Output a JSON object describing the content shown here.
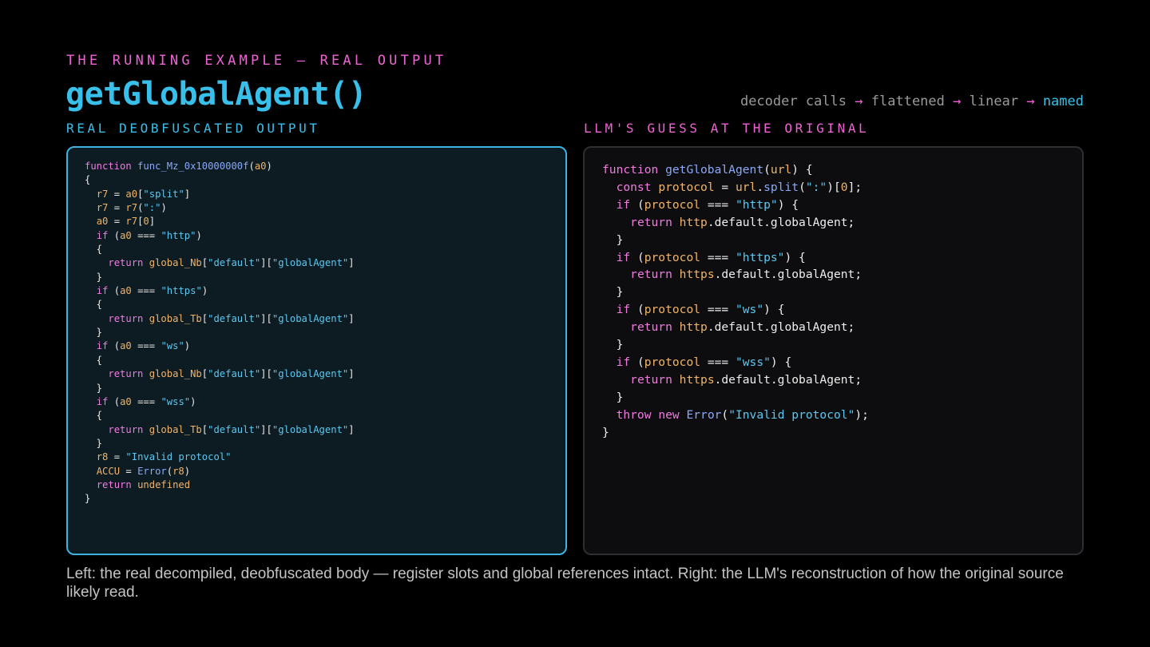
{
  "header": {
    "eyebrow": "THE RUNNING EXAMPLE — REAL OUTPUT",
    "title": "getGlobalAgent()",
    "pipeline": [
      "decoder calls",
      "flattened",
      "linear",
      "named"
    ],
    "arrow": "→"
  },
  "left": {
    "label": "REAL DEOBFUSCATED OUTPUT",
    "code": [
      [
        [
          "kw",
          "function"
        ],
        [
          "p",
          " "
        ],
        [
          "fn",
          "func_Mz_0x10000000f"
        ],
        [
          "p",
          "("
        ],
        [
          "var",
          "a0"
        ],
        [
          "p",
          ")"
        ]
      ],
      [
        [
          "p",
          "{"
        ]
      ],
      [
        [
          "p",
          "  "
        ],
        [
          "var",
          "r7"
        ],
        [
          "p",
          " = "
        ],
        [
          "var",
          "a0"
        ],
        [
          "p",
          "["
        ],
        [
          "str",
          "\"split\""
        ],
        [
          "p",
          "]"
        ]
      ],
      [
        [
          "p",
          "  "
        ],
        [
          "var",
          "r7"
        ],
        [
          "p",
          " = "
        ],
        [
          "var",
          "r7"
        ],
        [
          "p",
          "("
        ],
        [
          "str",
          "\":\""
        ],
        [
          "p",
          ")"
        ]
      ],
      [
        [
          "p",
          "  "
        ],
        [
          "var",
          "a0"
        ],
        [
          "p",
          " = "
        ],
        [
          "var",
          "r7"
        ],
        [
          "p",
          "["
        ],
        [
          "num",
          "0"
        ],
        [
          "p",
          "]"
        ]
      ],
      [
        [
          "p",
          "  "
        ],
        [
          "kw",
          "if"
        ],
        [
          "p",
          " ("
        ],
        [
          "var",
          "a0"
        ],
        [
          "p",
          " === "
        ],
        [
          "str",
          "\"http\""
        ],
        [
          "p",
          ")"
        ]
      ],
      [
        [
          "p",
          "  {"
        ]
      ],
      [
        [
          "p",
          "    "
        ],
        [
          "kw",
          "return"
        ],
        [
          "p",
          " "
        ],
        [
          "var",
          "global_Nb"
        ],
        [
          "p",
          "["
        ],
        [
          "str",
          "\"default\""
        ],
        [
          "p",
          "]["
        ],
        [
          "str",
          "\"globalAgent\""
        ],
        [
          "p",
          "]"
        ]
      ],
      [
        [
          "p",
          "  }"
        ]
      ],
      [
        [
          "p",
          "  "
        ],
        [
          "kw",
          "if"
        ],
        [
          "p",
          " ("
        ],
        [
          "var",
          "a0"
        ],
        [
          "p",
          " === "
        ],
        [
          "str",
          "\"https\""
        ],
        [
          "p",
          ")"
        ]
      ],
      [
        [
          "p",
          "  {"
        ]
      ],
      [
        [
          "p",
          "    "
        ],
        [
          "kw",
          "return"
        ],
        [
          "p",
          " "
        ],
        [
          "var",
          "global_Tb"
        ],
        [
          "p",
          "["
        ],
        [
          "str",
          "\"default\""
        ],
        [
          "p",
          "]["
        ],
        [
          "str",
          "\"globalAgent\""
        ],
        [
          "p",
          "]"
        ]
      ],
      [
        [
          "p",
          "  }"
        ]
      ],
      [
        [
          "p",
          "  "
        ],
        [
          "kw",
          "if"
        ],
        [
          "p",
          " ("
        ],
        [
          "var",
          "a0"
        ],
        [
          "p",
          " === "
        ],
        [
          "str",
          "\"ws\""
        ],
        [
          "p",
          ")"
        ]
      ],
      [
        [
          "p",
          "  {"
        ]
      ],
      [
        [
          "p",
          "    "
        ],
        [
          "kw",
          "return"
        ],
        [
          "p",
          " "
        ],
        [
          "var",
          "global_Nb"
        ],
        [
          "p",
          "["
        ],
        [
          "str",
          "\"default\""
        ],
        [
          "p",
          "]["
        ],
        [
          "str",
          "\"globalAgent\""
        ],
        [
          "p",
          "]"
        ]
      ],
      [
        [
          "p",
          "  }"
        ]
      ],
      [
        [
          "p",
          "  "
        ],
        [
          "kw",
          "if"
        ],
        [
          "p",
          " ("
        ],
        [
          "var",
          "a0"
        ],
        [
          "p",
          " === "
        ],
        [
          "str",
          "\"wss\""
        ],
        [
          "p",
          ")"
        ]
      ],
      [
        [
          "p",
          "  {"
        ]
      ],
      [
        [
          "p",
          "    "
        ],
        [
          "kw",
          "return"
        ],
        [
          "p",
          " "
        ],
        [
          "var",
          "global_Tb"
        ],
        [
          "p",
          "["
        ],
        [
          "str",
          "\"default\""
        ],
        [
          "p",
          "]["
        ],
        [
          "str",
          "\"globalAgent\""
        ],
        [
          "p",
          "]"
        ]
      ],
      [
        [
          "p",
          "  }"
        ]
      ],
      [
        [
          "p",
          "  "
        ],
        [
          "var",
          "r8"
        ],
        [
          "p",
          " = "
        ],
        [
          "str",
          "\"Invalid protocol\""
        ]
      ],
      [
        [
          "p",
          "  "
        ],
        [
          "var",
          "ACCU"
        ],
        [
          "p",
          " = "
        ],
        [
          "fn",
          "Error"
        ],
        [
          "p",
          "("
        ],
        [
          "var",
          "r8"
        ],
        [
          "p",
          ")"
        ]
      ],
      [
        [
          "p",
          "  "
        ],
        [
          "kw",
          "return"
        ],
        [
          "p",
          " "
        ],
        [
          "var",
          "undefined"
        ]
      ],
      [
        [
          "p",
          "}"
        ]
      ]
    ]
  },
  "right": {
    "label": "LLM'S GUESS AT THE ORIGINAL",
    "code": [
      [
        [
          "kw",
          "function"
        ],
        [
          "p",
          " "
        ],
        [
          "fn",
          "getGlobalAgent"
        ],
        [
          "p",
          "("
        ],
        [
          "var",
          "url"
        ],
        [
          "p",
          ") {"
        ]
      ],
      [
        [
          "p",
          "  "
        ],
        [
          "kw",
          "const"
        ],
        [
          "p",
          " "
        ],
        [
          "var",
          "protocol"
        ],
        [
          "p",
          " = "
        ],
        [
          "var",
          "url"
        ],
        [
          "p",
          "."
        ],
        [
          "fn",
          "split"
        ],
        [
          "p",
          "("
        ],
        [
          "str",
          "\":\""
        ],
        [
          "p",
          ")["
        ],
        [
          "num",
          "0"
        ],
        [
          "p",
          "];"
        ]
      ],
      [
        [
          "p",
          "  "
        ],
        [
          "kw",
          "if"
        ],
        [
          "p",
          " ("
        ],
        [
          "var",
          "protocol"
        ],
        [
          "p",
          " === "
        ],
        [
          "str",
          "\"http\""
        ],
        [
          "p",
          ") {"
        ]
      ],
      [
        [
          "p",
          "    "
        ],
        [
          "kw",
          "return"
        ],
        [
          "p",
          " "
        ],
        [
          "var",
          "http"
        ],
        [
          "p",
          ".default.globalAgent;"
        ]
      ],
      [
        [
          "p",
          "  }"
        ]
      ],
      [
        [
          "p",
          "  "
        ],
        [
          "kw",
          "if"
        ],
        [
          "p",
          " ("
        ],
        [
          "var",
          "protocol"
        ],
        [
          "p",
          " === "
        ],
        [
          "str",
          "\"https\""
        ],
        [
          "p",
          ") {"
        ]
      ],
      [
        [
          "p",
          "    "
        ],
        [
          "kw",
          "return"
        ],
        [
          "p",
          " "
        ],
        [
          "var",
          "https"
        ],
        [
          "p",
          ".default.globalAgent;"
        ]
      ],
      [
        [
          "p",
          "  }"
        ]
      ],
      [
        [
          "p",
          "  "
        ],
        [
          "kw",
          "if"
        ],
        [
          "p",
          " ("
        ],
        [
          "var",
          "protocol"
        ],
        [
          "p",
          " === "
        ],
        [
          "str",
          "\"ws\""
        ],
        [
          "p",
          ") {"
        ]
      ],
      [
        [
          "p",
          "    "
        ],
        [
          "kw",
          "return"
        ],
        [
          "p",
          " "
        ],
        [
          "var",
          "http"
        ],
        [
          "p",
          ".default.globalAgent;"
        ]
      ],
      [
        [
          "p",
          "  }"
        ]
      ],
      [
        [
          "p",
          "  "
        ],
        [
          "kw",
          "if"
        ],
        [
          "p",
          " ("
        ],
        [
          "var",
          "protocol"
        ],
        [
          "p",
          " === "
        ],
        [
          "str",
          "\"wss\""
        ],
        [
          "p",
          ") {"
        ]
      ],
      [
        [
          "p",
          "    "
        ],
        [
          "kw",
          "return"
        ],
        [
          "p",
          " "
        ],
        [
          "var",
          "https"
        ],
        [
          "p",
          ".default.globalAgent;"
        ]
      ],
      [
        [
          "p",
          "  }"
        ]
      ],
      [
        [
          "p",
          "  "
        ],
        [
          "kw",
          "throw"
        ],
        [
          "p",
          " "
        ],
        [
          "kw",
          "new"
        ],
        [
          "p",
          " "
        ],
        [
          "fn",
          "Error"
        ],
        [
          "p",
          "("
        ],
        [
          "str",
          "\"Invalid protocol\""
        ],
        [
          "p",
          ");"
        ]
      ],
      [
        [
          "p",
          "}"
        ]
      ]
    ]
  },
  "caption": "Left: the real decompiled, deobfuscated body — register slots and global references intact. Right: the LLM's reconstruction of how the original source likely read.",
  "colors": {
    "accent_pink": "#f062d6",
    "accent_cyan": "#38c0ea",
    "keyword": "#f17be0",
    "function": "#8aa9f8",
    "string": "#5cc8f0",
    "identifier": "#f0b46a"
  }
}
